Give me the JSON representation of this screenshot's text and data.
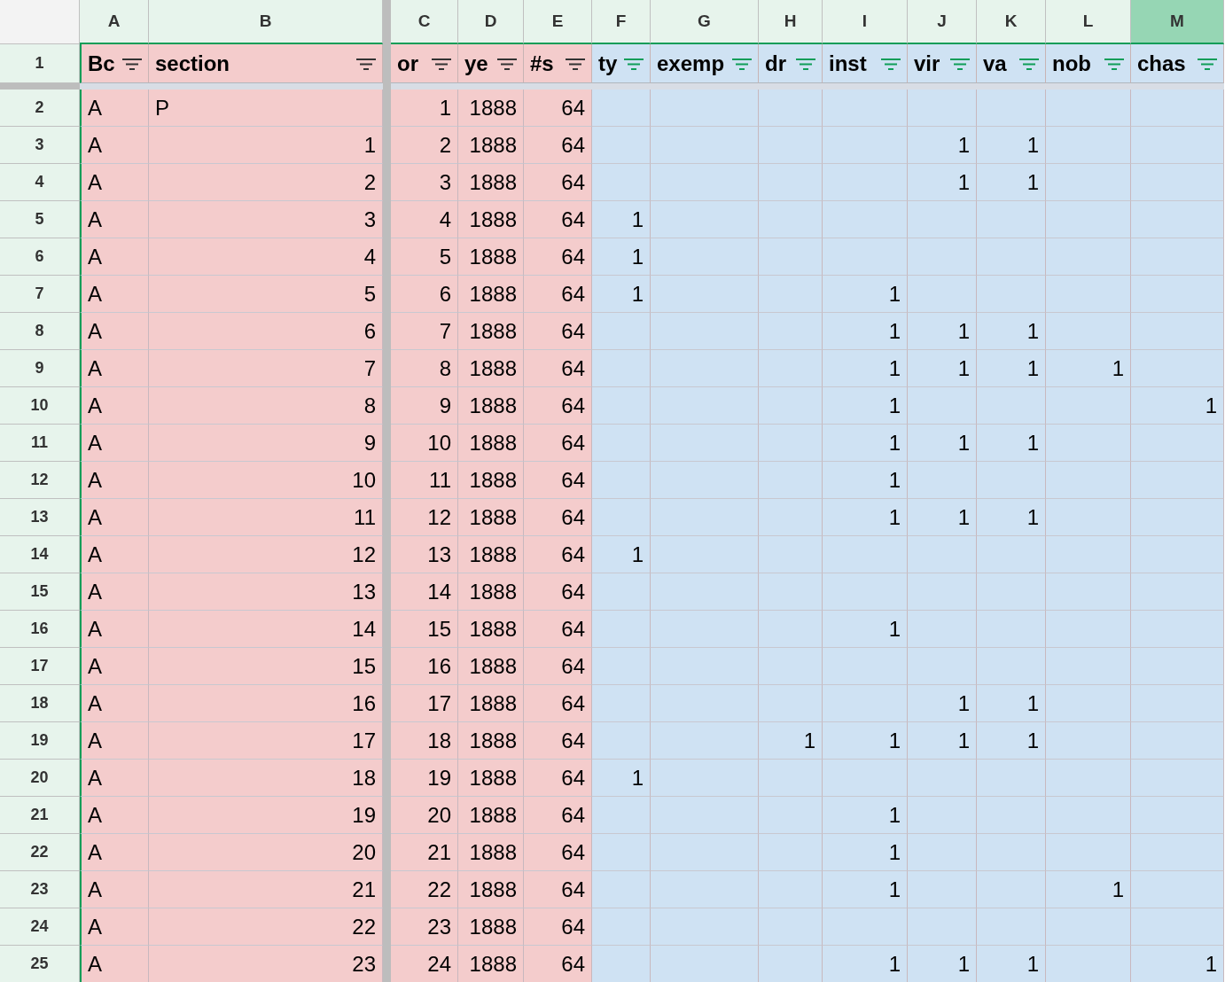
{
  "columns": [
    {
      "letter": "A",
      "header": "Bc",
      "filtered": false,
      "selected": false,
      "color": "#f4cccc"
    },
    {
      "letter": "B",
      "header": "section",
      "filtered": false,
      "selected": false,
      "color": "#f4cccc"
    },
    {
      "letter": "C",
      "header": "or",
      "filtered": false,
      "selected": false,
      "color": "#f4cccc"
    },
    {
      "letter": "D",
      "header": "ye",
      "filtered": false,
      "selected": false,
      "color": "#f4cccc"
    },
    {
      "letter": "E",
      "header": "#s",
      "filtered": false,
      "selected": false,
      "color": "#f4cccc"
    },
    {
      "letter": "F",
      "header": "ty",
      "filtered": true,
      "selected": false,
      "color": "#cfe2f3"
    },
    {
      "letter": "G",
      "header": "exemp",
      "filtered": true,
      "selected": false,
      "color": "#cfe2f3"
    },
    {
      "letter": "H",
      "header": "dr",
      "filtered": true,
      "selected": false,
      "color": "#cfe2f3"
    },
    {
      "letter": "I",
      "header": "inst",
      "filtered": true,
      "selected": false,
      "color": "#cfe2f3"
    },
    {
      "letter": "J",
      "header": "vir",
      "filtered": true,
      "selected": false,
      "color": "#cfe2f3"
    },
    {
      "letter": "K",
      "header": "va",
      "filtered": true,
      "selected": false,
      "color": "#cfe2f3"
    },
    {
      "letter": "L",
      "header": "nob",
      "filtered": true,
      "selected": false,
      "color": "#cfe2f3"
    },
    {
      "letter": "M",
      "header": "chas",
      "filtered": true,
      "selected": true,
      "color": "#cfe2f3"
    }
  ],
  "header_row_number": "1",
  "rows": [
    {
      "number": "2",
      "cells": [
        "A",
        "P",
        "1",
        "1888",
        "64",
        null,
        null,
        null,
        null,
        null,
        null,
        null,
        null
      ]
    },
    {
      "number": "3",
      "cells": [
        "A",
        "1",
        "2",
        "1888",
        "64",
        null,
        null,
        null,
        null,
        "1",
        "1",
        null,
        null
      ]
    },
    {
      "number": "4",
      "cells": [
        "A",
        "2",
        "3",
        "1888",
        "64",
        null,
        null,
        null,
        null,
        "1",
        "1",
        null,
        null
      ]
    },
    {
      "number": "5",
      "cells": [
        "A",
        "3",
        "4",
        "1888",
        "64",
        "1",
        null,
        null,
        null,
        null,
        null,
        null,
        null
      ]
    },
    {
      "number": "6",
      "cells": [
        "A",
        "4",
        "5",
        "1888",
        "64",
        "1",
        null,
        null,
        null,
        null,
        null,
        null,
        null
      ]
    },
    {
      "number": "7",
      "cells": [
        "A",
        "5",
        "6",
        "1888",
        "64",
        "1",
        null,
        null,
        "1",
        null,
        null,
        null,
        null
      ]
    },
    {
      "number": "8",
      "cells": [
        "A",
        "6",
        "7",
        "1888",
        "64",
        null,
        null,
        null,
        "1",
        "1",
        "1",
        null,
        null
      ]
    },
    {
      "number": "9",
      "cells": [
        "A",
        "7",
        "8",
        "1888",
        "64",
        null,
        null,
        null,
        "1",
        "1",
        "1",
        "1",
        null
      ]
    },
    {
      "number": "10",
      "cells": [
        "A",
        "8",
        "9",
        "1888",
        "64",
        null,
        null,
        null,
        "1",
        null,
        null,
        null,
        "1"
      ]
    },
    {
      "number": "11",
      "cells": [
        "A",
        "9",
        "10",
        "1888",
        "64",
        null,
        null,
        null,
        "1",
        "1",
        "1",
        null,
        null
      ]
    },
    {
      "number": "12",
      "cells": [
        "A",
        "10",
        "11",
        "1888",
        "64",
        null,
        null,
        null,
        "1",
        null,
        null,
        null,
        null
      ]
    },
    {
      "number": "13",
      "cells": [
        "A",
        "11",
        "12",
        "1888",
        "64",
        null,
        null,
        null,
        "1",
        "1",
        "1",
        null,
        null
      ]
    },
    {
      "number": "14",
      "cells": [
        "A",
        "12",
        "13",
        "1888",
        "64",
        "1",
        null,
        null,
        null,
        null,
        null,
        null,
        null
      ]
    },
    {
      "number": "15",
      "cells": [
        "A",
        "13",
        "14",
        "1888",
        "64",
        null,
        null,
        null,
        null,
        null,
        null,
        null,
        null
      ]
    },
    {
      "number": "16",
      "cells": [
        "A",
        "14",
        "15",
        "1888",
        "64",
        null,
        null,
        null,
        "1",
        null,
        null,
        null,
        null
      ]
    },
    {
      "number": "17",
      "cells": [
        "A",
        "15",
        "16",
        "1888",
        "64",
        null,
        null,
        null,
        null,
        null,
        null,
        null,
        null
      ]
    },
    {
      "number": "18",
      "cells": [
        "A",
        "16",
        "17",
        "1888",
        "64",
        null,
        null,
        null,
        null,
        "1",
        "1",
        null,
        null
      ]
    },
    {
      "number": "19",
      "cells": [
        "A",
        "17",
        "18",
        "1888",
        "64",
        null,
        null,
        "1",
        "1",
        "1",
        "1",
        null,
        null
      ]
    },
    {
      "number": "20",
      "cells": [
        "A",
        "18",
        "19",
        "1888",
        "64",
        "1",
        null,
        null,
        null,
        null,
        null,
        null,
        null
      ]
    },
    {
      "number": "21",
      "cells": [
        "A",
        "19",
        "20",
        "1888",
        "64",
        null,
        null,
        null,
        "1",
        null,
        null,
        null,
        null
      ]
    },
    {
      "number": "22",
      "cells": [
        "A",
        "20",
        "21",
        "1888",
        "64",
        null,
        null,
        null,
        "1",
        null,
        null,
        null,
        null
      ]
    },
    {
      "number": "23",
      "cells": [
        "A",
        "21",
        "22",
        "1888",
        "64",
        null,
        null,
        null,
        "1",
        null,
        null,
        "1",
        null
      ]
    },
    {
      "number": "24",
      "cells": [
        "A",
        "22",
        "23",
        "1888",
        "64",
        null,
        null,
        null,
        null,
        null,
        null,
        null,
        null
      ]
    },
    {
      "number": "25",
      "cells": [
        "A",
        "23",
        "24",
        "1888",
        "64",
        null,
        null,
        null,
        "1",
        "1",
        "1",
        null,
        "1"
      ]
    }
  ]
}
